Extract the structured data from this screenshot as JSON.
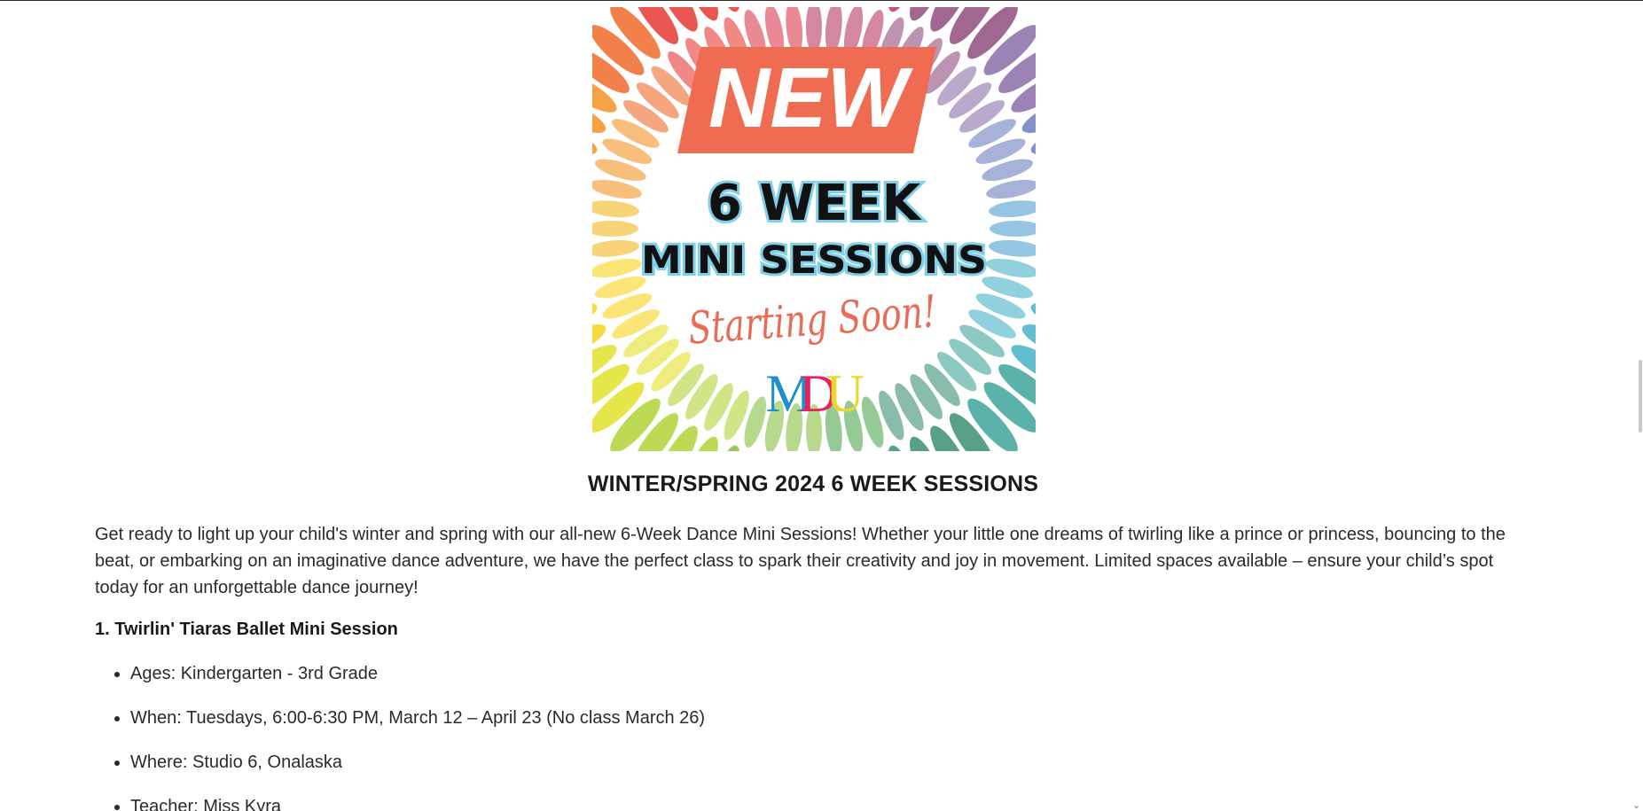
{
  "hero": {
    "headline": "NEW",
    "line1": "6 WEEK",
    "line2": "MINI SESSIONS",
    "script_text": "Starting Soon!",
    "logo_letters": [
      "M",
      "D",
      "U"
    ],
    "colors": {
      "banner": "#ef6b52",
      "outline": "#7fd0e8",
      "script": "#ea6b54",
      "logo_m": "#1f8fc9",
      "logo_d": "#e8215a",
      "logo_u": "#e6d92c"
    }
  },
  "heading": "WINTER/SPRING 2024 6 WEEK SESSIONS",
  "intro": "Get ready to light up your child's winter and spring with our all-new 6-Week Dance Mini Sessions! Whether your little one dreams of twirling like a prince or princess, bouncing to the beat, or embarking on an imaginative dance adventure, we have the perfect class to spark their creativity and joy in movement. Limited spaces available – ensure your child’s spot today for an unforgettable dance journey!",
  "session1": {
    "title": "1. Twirlin' Tiaras Ballet Mini Session",
    "details": [
      "Ages: Kindergarten - 3rd Grade",
      "When: Tuesdays, 6:00-6:30 PM, March 12 – April 23 (No class March 26)",
      "Where: Studio 6, Onalaska",
      "Teacher: Miss Kyra"
    ]
  },
  "scrollbar": {
    "down_arrow": "⌄"
  }
}
